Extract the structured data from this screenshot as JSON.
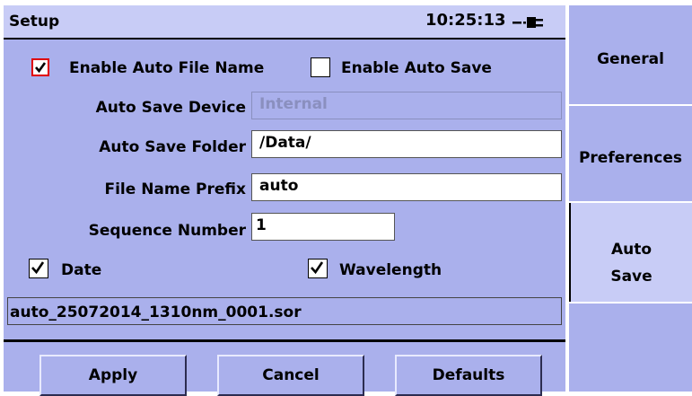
{
  "header": {
    "title": "Setup",
    "time": "10:25:13",
    "power_icon": "plug-icon"
  },
  "options": {
    "enable_auto_file_name": {
      "label": "Enable Auto File Name",
      "checked": true
    },
    "enable_auto_save": {
      "label": "Enable Auto Save",
      "checked": false
    },
    "date": {
      "label": "Date",
      "checked": true
    },
    "wavelength": {
      "label": "Wavelength",
      "checked": true
    }
  },
  "fields": {
    "auto_save_device": {
      "label": "Auto Save Device",
      "value": "Internal"
    },
    "auto_save_folder": {
      "label": "Auto Save Folder",
      "value": " /Data/"
    },
    "file_name_prefix": {
      "label": "File Name Prefix",
      "value": "auto"
    },
    "sequence_number": {
      "label": "Sequence Number",
      "value": "1"
    }
  },
  "preview": {
    "filename": "auto_25072014_1310nm_0001.sor"
  },
  "buttons": {
    "apply": "Apply",
    "cancel": "Cancel",
    "defaults": "Defaults"
  },
  "tabs": [
    {
      "line1": "General",
      "line2": "",
      "selected": false
    },
    {
      "line1": "Preferences",
      "line2": "",
      "selected": false
    },
    {
      "line1": "Auto",
      "line2": "Save",
      "selected": true
    }
  ],
  "colors": {
    "panel": "#aab0ec",
    "panel_light": "#c8ccf6",
    "accent_red": "#e00000"
  }
}
